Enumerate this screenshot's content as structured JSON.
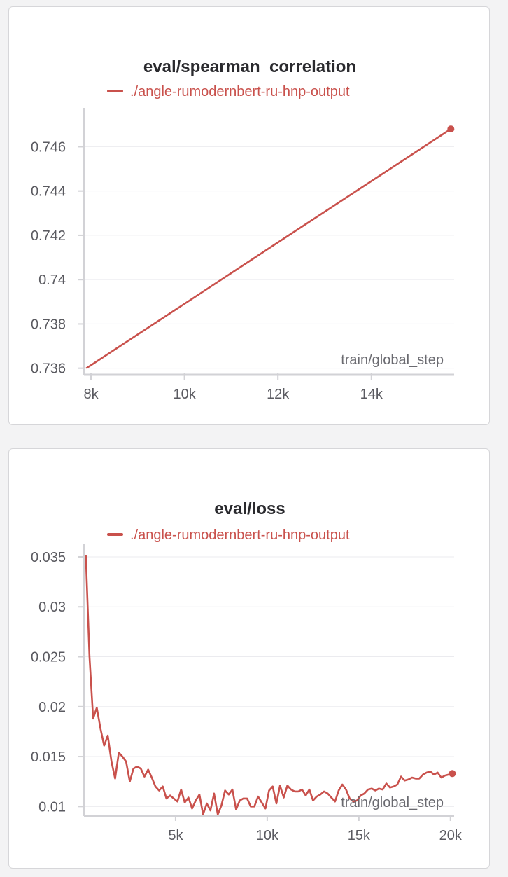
{
  "charts": [
    {
      "chart_data": {
        "type": "line",
        "title": "eval/spearman_correlation",
        "xlabel": "train/global_step",
        "ylabel": "",
        "series": [
          {
            "name": "./angle-rumodernbert-ru-hnp-output",
            "color": "#c9514c",
            "x": [
              7900,
              15700
            ],
            "y": [
              0.736,
              0.7468
            ]
          }
        ],
        "xlim": [
          7850,
          15770
        ],
        "ylim": [
          0.7358,
          0.7475
        ],
        "xticks": [
          8000,
          10000,
          12000,
          14000
        ],
        "xtick_labels": [
          "8k",
          "10k",
          "12k",
          "14k"
        ],
        "yticks": [
          0.736,
          0.738,
          0.74,
          0.742,
          0.744,
          0.746
        ],
        "ytick_labels": [
          "0.736",
          "0.738",
          "0.74",
          "0.742",
          "0.744",
          "0.746"
        ],
        "grid": true,
        "legend_position": "top-center"
      }
    },
    {
      "chart_data": {
        "type": "line",
        "title": "eval/loss",
        "xlabel": "train/global_step",
        "ylabel": "",
        "series": [
          {
            "name": "./angle-rumodernbert-ru-hnp-output",
            "color": "#c9514c",
            "x": [
              100,
              300,
              500,
              700,
              900,
              1100,
              1300,
              1500,
              1700,
              1900,
              2100,
              2300,
              2500,
              2700,
              2900,
              3100,
              3300,
              3500,
              3700,
              3900,
              4100,
              4300,
              4500,
              4700,
              4900,
              5100,
              5300,
              5500,
              5700,
              5900,
              6100,
              6300,
              6500,
              6700,
              6900,
              7100,
              7300,
              7500,
              7700,
              7900,
              8100,
              8300,
              8500,
              8700,
              8900,
              9100,
              9300,
              9500,
              9700,
              9900,
              10100,
              10300,
              10500,
              10700,
              10900,
              11100,
              11300,
              11500,
              11700,
              11900,
              12100,
              12300,
              12500,
              12700,
              12900,
              13100,
              13300,
              13500,
              13700,
              13900,
              14100,
              14300,
              14500,
              14700,
              14900,
              15100,
              15300,
              15500,
              15700,
              15900,
              16100,
              16300,
              16500,
              16700,
              16900,
              17100,
              17300,
              17500,
              17700,
              17900,
              18100,
              18300,
              18500,
              18700,
              18900,
              19100,
              19300,
              19500,
              19700,
              19900,
              20100
            ],
            "y": [
              0.0352,
              0.025,
              0.0188,
              0.0199,
              0.0178,
              0.0161,
              0.0171,
              0.0145,
              0.0128,
              0.0154,
              0.015,
              0.0145,
              0.0125,
              0.0138,
              0.014,
              0.0138,
              0.013,
              0.0137,
              0.0129,
              0.012,
              0.0116,
              0.012,
              0.0108,
              0.0111,
              0.0108,
              0.0105,
              0.0117,
              0.0104,
              0.0109,
              0.0098,
              0.0106,
              0.0112,
              0.0092,
              0.0103,
              0.0096,
              0.0113,
              0.0092,
              0.0101,
              0.0116,
              0.0112,
              0.0117,
              0.0097,
              0.0106,
              0.0108,
              0.0108,
              0.01,
              0.01,
              0.011,
              0.0104,
              0.0098,
              0.0116,
              0.012,
              0.0103,
              0.0121,
              0.0109,
              0.0121,
              0.0117,
              0.0115,
              0.0115,
              0.0117,
              0.0111,
              0.0117,
              0.0106,
              0.011,
              0.0112,
              0.0115,
              0.0113,
              0.0109,
              0.0105,
              0.0116,
              0.0122,
              0.0117,
              0.0108,
              0.0105,
              0.0106,
              0.0111,
              0.0113,
              0.0117,
              0.0118,
              0.0116,
              0.0118,
              0.0117,
              0.0123,
              0.0119,
              0.012,
              0.0122,
              0.013,
              0.0126,
              0.0127,
              0.0129,
              0.0128,
              0.0128,
              0.0132,
              0.0134,
              0.0135,
              0.0132,
              0.0134,
              0.0129,
              0.0131,
              0.0132,
              0.0133
            ]
          }
        ],
        "xlim": [
          0,
          20200
        ],
        "ylim": [
          0.0089,
          0.0357
        ],
        "xticks": [
          5000,
          10000,
          15000,
          20000
        ],
        "xtick_labels": [
          "5k",
          "10k",
          "15k",
          "20k"
        ],
        "yticks": [
          0.01,
          0.015,
          0.02,
          0.025,
          0.03,
          0.035
        ],
        "ytick_labels": [
          "0.01",
          "0.015",
          "0.02",
          "0.025",
          "0.03",
          "0.035"
        ],
        "grid": true,
        "legend_position": "top-center"
      }
    }
  ]
}
